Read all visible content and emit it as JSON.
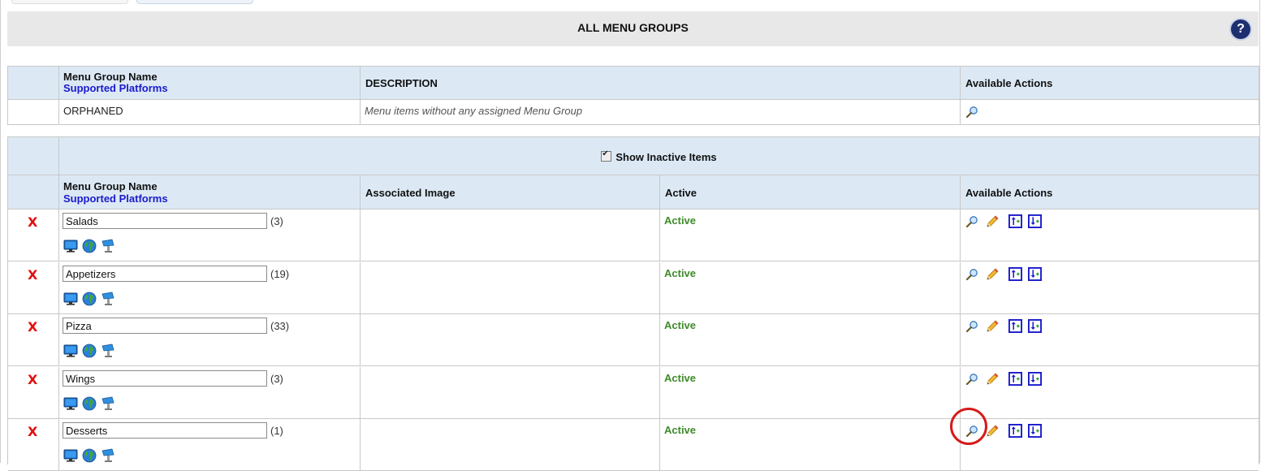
{
  "header": {
    "title": "ALL MENU GROUPS",
    "help_label": "?"
  },
  "orphan_table": {
    "columns": {
      "name": "Menu Group Name",
      "platforms": "Supported Platforms",
      "description": "DESCRIPTION",
      "actions": "Available Actions"
    },
    "row": {
      "name": "ORPHANED",
      "description": "Menu items without any assigned Menu Group"
    }
  },
  "groups_table": {
    "show_inactive_label": "Show Inactive Items",
    "show_inactive_checked": true,
    "columns": {
      "name": "Menu Group Name",
      "platforms": "Supported Platforms",
      "image": "Associated Image",
      "active": "Active",
      "actions": "Available Actions"
    },
    "delete_glyph": "X",
    "rows": [
      {
        "name": "Salads",
        "count": "(3)",
        "status": "Active"
      },
      {
        "name": "Appetizers",
        "count": "(19)",
        "status": "Active"
      },
      {
        "name": "Pizza",
        "count": "(33)",
        "status": "Active"
      },
      {
        "name": "Wings",
        "count": "(3)",
        "status": "Active"
      },
      {
        "name": "Desserts",
        "count": "(1)",
        "status": "Active"
      }
    ]
  },
  "icons": {
    "platforms": [
      "desktop-icon",
      "globe-icon",
      "kiosk-icon"
    ],
    "actions": [
      "view-icon",
      "edit-icon",
      "move-up-icon",
      "move-down-icon"
    ]
  },
  "colors": {
    "active": "#3f8a2a",
    "delete": "#e01010",
    "header_bg": "#dce9f5",
    "link_blue": "#1a1acc"
  }
}
